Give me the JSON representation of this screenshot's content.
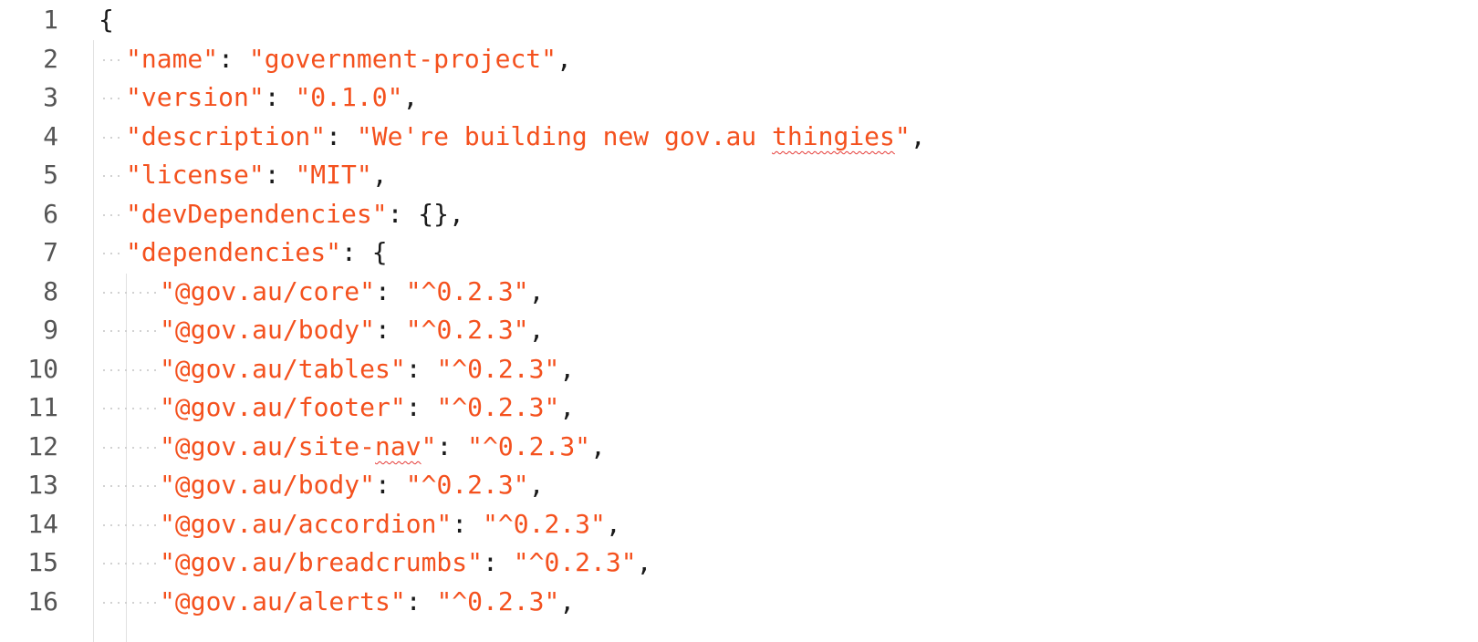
{
  "editor": {
    "line_numbers": [
      "1",
      "2",
      "3",
      "4",
      "5",
      "6",
      "7",
      "8",
      "9",
      "10",
      "11",
      "12",
      "13",
      "14",
      "15",
      "16"
    ],
    "lines": {
      "l1": {
        "open_brace": "{"
      },
      "l2": {
        "key": "\"name\"",
        "colon": ":",
        "value": "\"government-project\"",
        "comma": ","
      },
      "l3": {
        "key": "\"version\"",
        "colon": ":",
        "value": "\"0.1.0\"",
        "comma": ","
      },
      "l4": {
        "key": "\"description\"",
        "colon": ":",
        "value_prefix": "\"We're building new gov.au ",
        "value_misspelled": "thingies",
        "value_suffix": "\"",
        "comma": ","
      },
      "l5": {
        "key": "\"license\"",
        "colon": ":",
        "value": "\"MIT\"",
        "comma": ","
      },
      "l6": {
        "key": "\"devDependencies\"",
        "colon": ":",
        "value": "{}",
        "comma": ","
      },
      "l7": {
        "key": "\"dependencies\"",
        "colon": ":",
        "open_brace": "{"
      },
      "l8": {
        "key": "\"@gov.au/core\"",
        "colon": ":",
        "value": "\"^0.2.3\"",
        "comma": ","
      },
      "l9": {
        "key": "\"@gov.au/body\"",
        "colon": ":",
        "value": "\"^0.2.3\"",
        "comma": ","
      },
      "l10": {
        "key": "\"@gov.au/tables\"",
        "colon": ":",
        "value": "\"^0.2.3\"",
        "comma": ","
      },
      "l11": {
        "key": "\"@gov.au/footer\"",
        "colon": ":",
        "value": "\"^0.2.3\"",
        "comma": ","
      },
      "l12": {
        "key_prefix": "\"@gov.au/site-",
        "key_misspelled": "nav",
        "key_suffix": "\"",
        "colon": ":",
        "value": "\"^0.2.3\"",
        "comma": ","
      },
      "l13": {
        "key": "\"@gov.au/body\"",
        "colon": ":",
        "value": "\"^0.2.3\"",
        "comma": ","
      },
      "l14": {
        "key": "\"@gov.au/accordion\"",
        "colon": ":",
        "value": "\"^0.2.3\"",
        "comma": ","
      },
      "l15": {
        "key": "\"@gov.au/breadcrumbs\"",
        "colon": ":",
        "value": "\"^0.2.3\"",
        "comma": ","
      },
      "l16": {
        "key": "\"@gov.au/alerts\"",
        "colon": ":",
        "value": "\"^0.2.3\"",
        "comma": ","
      }
    },
    "colors": {
      "string": "#f4511e",
      "punctuation": "#1a1a1a",
      "line_number": "#555555",
      "spellcheck_underline": "#e53935",
      "indent_guide": "#e2e2e2"
    }
  }
}
